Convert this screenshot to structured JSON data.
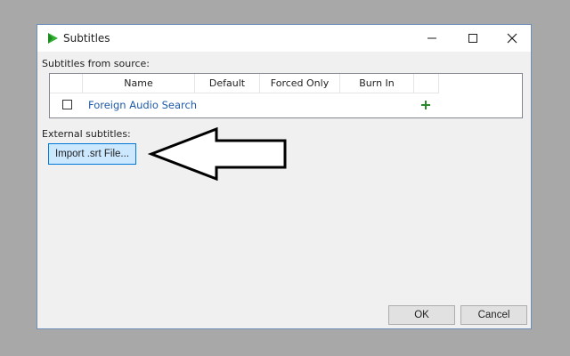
{
  "window": {
    "title": "Subtitles",
    "icon": "play-logo-icon"
  },
  "source_section": {
    "label": "Subtitles from source:",
    "columns": [
      "Name",
      "Default",
      "Forced Only",
      "Burn In"
    ],
    "rows": [
      {
        "name": "Foreign Audio Search",
        "checked": false
      }
    ],
    "add_icon": "plus-icon"
  },
  "external_section": {
    "label": "External subtitles:",
    "import_button": "Import .srt File..."
  },
  "footer": {
    "ok": "OK",
    "cancel": "Cancel"
  },
  "colors": {
    "link_text": "#1e5aa8",
    "add_icon": "#2a8a2a",
    "accent_border": "#0078d7",
    "import_bg": "#cce8ff",
    "logo": "#2fb02f"
  }
}
